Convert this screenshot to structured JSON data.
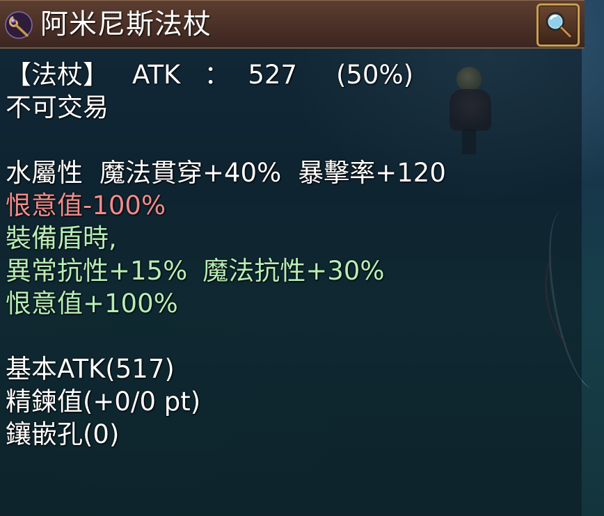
{
  "item": {
    "name": "阿米尼斯法杖",
    "icon": "staff-icon",
    "inspect_icon": "magnifier-icon"
  },
  "weapon": {
    "type": "【法杖】",
    "atk_label": "ATK",
    "separator": "：",
    "atk_value": "527",
    "atk_percent": "(50%)"
  },
  "trade_status": "不可交易",
  "effects": {
    "element": "水屬性",
    "magic_pierce": "魔法貫穿+40%",
    "crit_rate": "暴擊率+120",
    "hate_down": "恨意值-100%",
    "shield_condition": "裝備盾時,",
    "ailment_resist": "異常抗性+15%",
    "magic_resist": "魔法抗性+30%",
    "hate_up": "恨意值+100%"
  },
  "stats": {
    "base_atk": "基本ATK(517)",
    "refine": "精鍊值(+0/0 pt)",
    "slots": "鑲嵌孔(0)"
  },
  "colors": {
    "normal_text": "#ffffff",
    "negative_text": "#f08c8c",
    "conditional_text": "#b6eeb6",
    "title_bar": "#4a3027",
    "button_border": "#c8a050"
  }
}
